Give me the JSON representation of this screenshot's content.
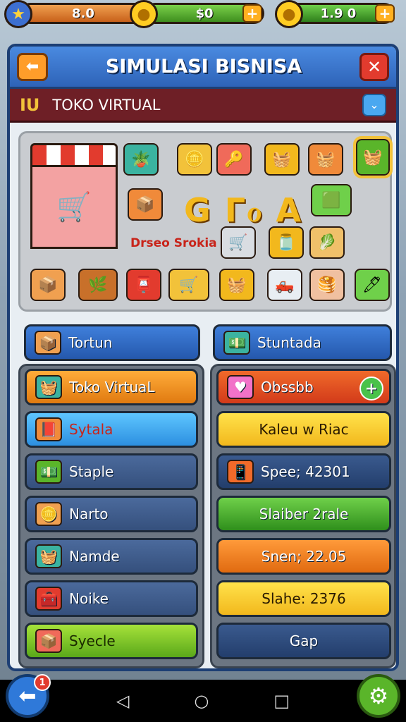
{
  "hud": {
    "bar1_value": "8.0",
    "bar2_value": "$0",
    "bar3_value": "1.9 0",
    "star_icon": "★",
    "coin_icon": "●",
    "plus": "+"
  },
  "header": {
    "back_icon": "⬅",
    "title": "SIMULASI BISNISA",
    "close_icon": "✕"
  },
  "subheader": {
    "icon": "IU",
    "title": "TOKO VIRTUAL",
    "dropdown_icon": "⌄"
  },
  "grid": {
    "big_text": "G Γℴ A",
    "brand_label": "Drseo Srokia"
  },
  "tabs": {
    "left": "Tortun",
    "right": "Stuntada"
  },
  "left_menu": [
    {
      "label": "Toko VirtuaL",
      "icon": "🧺"
    },
    {
      "label": "Sytala",
      "icon": "📕"
    },
    {
      "label": "Staple",
      "icon": "💵"
    },
    {
      "label": "Narto",
      "icon": "🪙"
    },
    {
      "label": "Namde",
      "icon": "🧺"
    },
    {
      "label": "Noike",
      "icon": "🧰"
    },
    {
      "label": "Syecle",
      "icon": "📦"
    }
  ],
  "right_menu": [
    {
      "label": "Obssbb",
      "icon": "♥"
    },
    {
      "label": "Kaleu w Riac"
    },
    {
      "label": "Spee; 42301",
      "icon": "📱"
    },
    {
      "label": "Slaiber 2rale"
    },
    {
      "label": "Snen; 22.05"
    },
    {
      "label": "Slahe: 2376"
    },
    {
      "label": "Gap"
    }
  ],
  "colors": {
    "panel_border": "#1d3f74",
    "header_blue": "#2e63b8",
    "subheader_red": "#6e1f26",
    "accent_orange": "#ff9d2a"
  },
  "nav": {
    "back": "◁",
    "home": "○",
    "recent": "□",
    "badge": "1"
  }
}
